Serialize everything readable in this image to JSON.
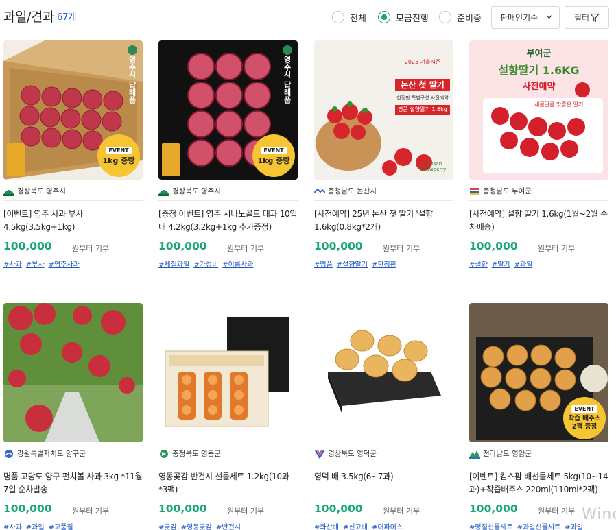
{
  "header": {
    "title": "과일/견과",
    "count": "67개",
    "filters": [
      "전체",
      "모금진행",
      "준비중"
    ],
    "active_filter": "모금진행",
    "sort_selected": "판매인기순",
    "filter_button": "필터"
  },
  "colors": {
    "accent": "#18a57a",
    "tag": "#1f57c3",
    "badge": "#f7c531"
  },
  "products": [
    {
      "region": "경상북도 영주시",
      "name": "[이벤트] 영주 사과 부사 4.5kg(3.5kg+1kg)",
      "price": "100,000",
      "price_suffix": "원부터 기부",
      "tags": [
        "#사과",
        "#부사",
        "#영주사과"
      ],
      "badge_event": "EVENT",
      "badge_text": "1kg 증량",
      "label_vertical": "영주시 답례품"
    },
    {
      "region": "경상북도 영주시",
      "name": "[증정 이벤트] 영주 시나노골드 대과 10입내 4.2kg(3.2kg+1kg 추가증정)",
      "price": "100,000",
      "price_suffix": "원부터 기부",
      "tags": [
        "#제철과일",
        "#가성비",
        "#이름사과"
      ],
      "badge_event": "EVENT",
      "badge_text": "1kg 증량",
      "label_vertical": "영주시 답례품"
    },
    {
      "region": "충청남도 논산시",
      "name": "[사전예약] 25년 논산 첫 딸기 '설향' 1.6kg(0.8kg*2개)",
      "price": "100,000",
      "price_suffix": "원부터 기부",
      "tags": [
        "#명품",
        "#설향딸기",
        "#한정판"
      ],
      "image_text": {
        "year": "2025 겨울시즌",
        "title": "논산 첫 딸기",
        "sub1": "한정판 특별구성 사전예약",
        "sub2": "명품 설향딸기 1.6kg",
        "en": "Nonsan Strawberry"
      }
    },
    {
      "region": "충청남도 부여군",
      "name": "[사전예약] 설향 딸기 1.6kg(1월~2월 순차배송)",
      "price": "100,000",
      "price_suffix": "원부터 기부",
      "tags": [
        "#설향",
        "#딸기",
        "#과일"
      ],
      "image_text": {
        "top": "부여군",
        "title": "설향딸기 1.6KG",
        "sub": "사전예약",
        "tag": "새콤달콤 맛좋은 딸기"
      }
    },
    {
      "region": "강원특별자치도 양구군",
      "name": "명품 고당도 양구 펀치볼 사과 3kg *11월 7일 순차발송",
      "price": "100,000",
      "price_suffix": "원부터 기부",
      "tags": [
        "#사과",
        "#과일",
        "#고품질"
      ]
    },
    {
      "region": "충청북도 영동군",
      "name": "영동곶감 반건시 선물세트 1.2kg(10과*3팩)",
      "price": "100,000",
      "price_suffix": "원부터 기부",
      "tags": [
        "#곶감",
        "#영동곶감",
        "#반건시"
      ]
    },
    {
      "region": "경상북도 영덕군",
      "name": "영덕 배 3.5kg(6~7과)",
      "price": "100,000",
      "price_suffix": "원부터 기부",
      "tags": [
        "#화산배",
        "#신고배",
        "#더파머스"
      ]
    },
    {
      "region": "전라남도 영암군",
      "name": "[이벤트] 킴스팜 배선물세트 5kg(10~14과)+착즙배주스 220ml(110ml*2팩)",
      "price": "100,000",
      "price_suffix": "원부터 기부",
      "tags": [
        "#명절선물세트",
        "#과일선물세트",
        "#과일"
      ],
      "badge_event": "EVENT",
      "badge_text": "착즙 배주스 2팩 증정"
    }
  ],
  "watermark": "Wind"
}
